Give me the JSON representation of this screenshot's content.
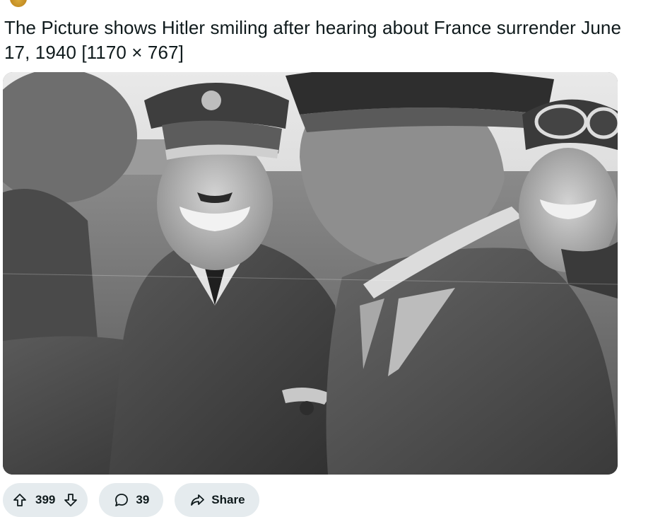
{
  "post": {
    "title": "The Picture shows Hitler smiling after hearing about France surrender June 17, 1940 [1170 × 767]",
    "image_alt": "Black and white photograph of a group of uniformed officers laughing outdoors"
  },
  "actions": {
    "upvotes": "399",
    "comments": "39",
    "share_label": "Share"
  },
  "icons": {
    "upvote": "upvote-arrow-icon",
    "downvote": "downvote-arrow-icon",
    "comment": "comment-bubble-icon",
    "share": "share-arrow-icon"
  }
}
